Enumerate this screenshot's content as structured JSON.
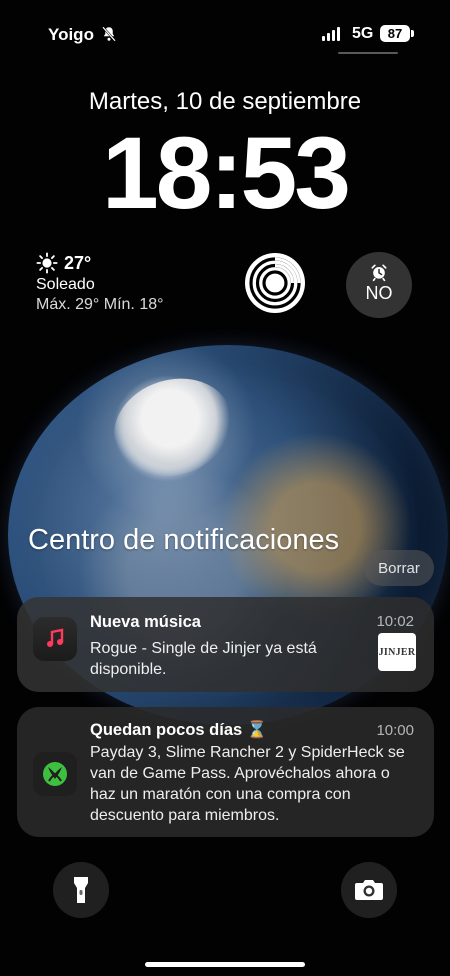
{
  "status": {
    "carrier": "Yoigo",
    "network": "5G",
    "battery": "87"
  },
  "lock": {
    "date": "Martes, 10 de septiembre",
    "time": "18:53"
  },
  "widgets": {
    "weather": {
      "temperature": "27°",
      "condition": "Soleado",
      "range": "Máx. 29° Mín. 18°"
    },
    "alarm": {
      "label": "NO"
    }
  },
  "notifications": {
    "title": "Centro de notificaciones",
    "clear_label": "Borrar",
    "items": [
      {
        "title": "Nueva música",
        "time": "10:02",
        "body": "Rogue - Single de Jinjer ya está disponible.",
        "thumb_text": "JINJER"
      },
      {
        "title": "Quedan pocos días ⌛",
        "time": "10:00",
        "body": "Payday 3, Slime Rancher 2 y SpiderHeck se van de Game Pass. Aprovéchalos ahora o haz un maratón con una compra con descuento para miembros."
      }
    ]
  },
  "icons": {
    "status": [
      "bell-slash-icon",
      "signal-icon"
    ],
    "widgets": [
      "sun-icon",
      "activity-rings-icon",
      "alarm-icon"
    ],
    "apps": [
      "music-note-icon",
      "xbox-icon"
    ],
    "bottom": [
      "flashlight-icon",
      "camera-icon"
    ]
  }
}
